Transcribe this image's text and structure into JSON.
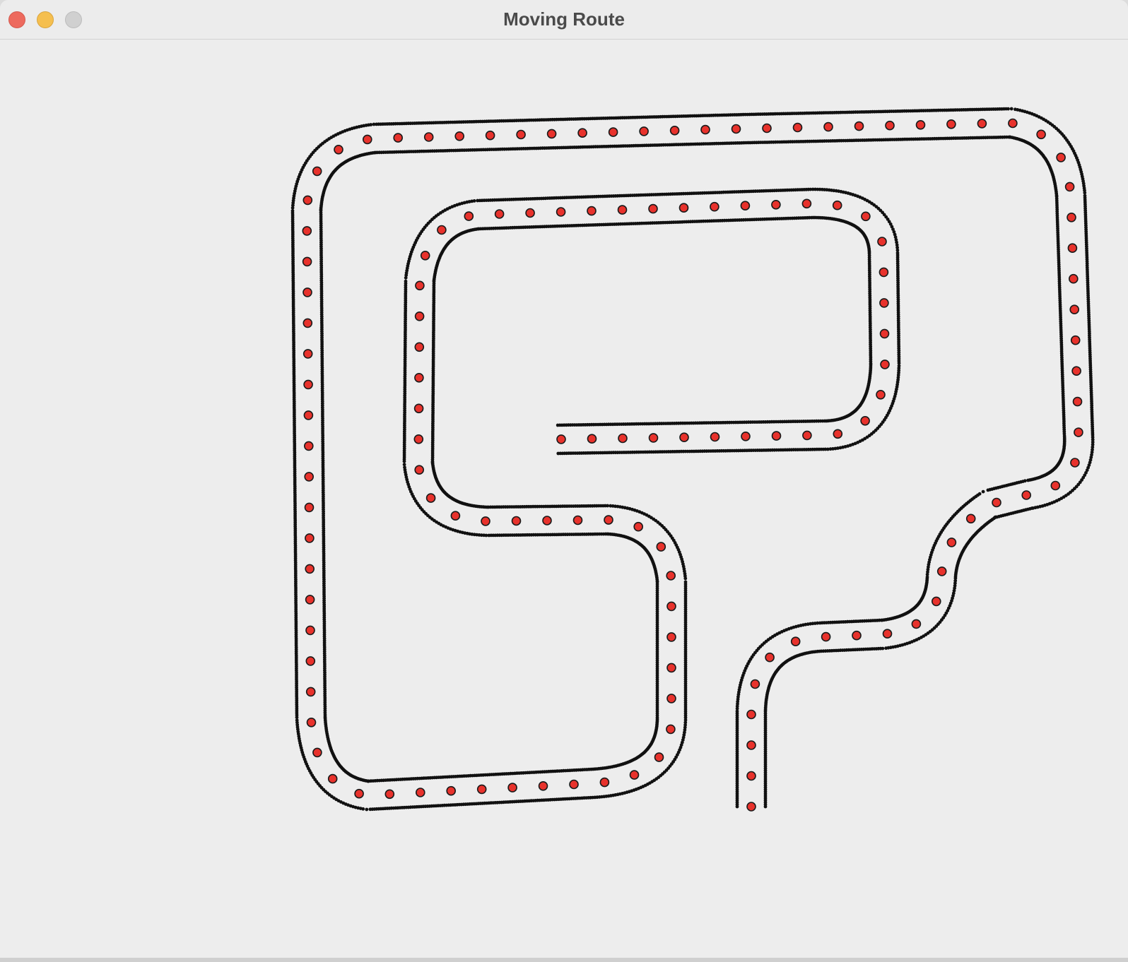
{
  "window": {
    "title": "Moving Route"
  },
  "controls": {
    "close_icon": "close-icon",
    "minimize_icon": "minimize-icon",
    "zoom_icon": "zoom-icon"
  },
  "colors": {
    "background": "#ededed",
    "track_edge": "#111111",
    "marker_fill": "#e8322c",
    "marker_stroke": "#1a1a1a"
  }
}
